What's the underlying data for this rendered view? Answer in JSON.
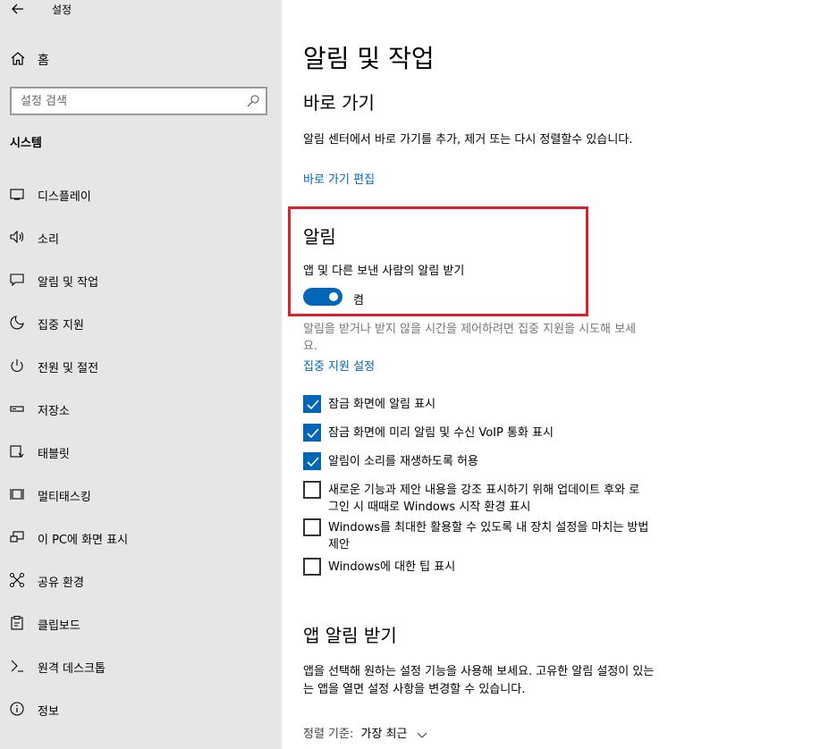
{
  "window": {
    "title": "설정",
    "back_icon": "back-arrow-icon"
  },
  "sidebar": {
    "home_label": "홈",
    "search_placeholder": "설정 검색",
    "section_title": "시스템",
    "items": [
      {
        "label": "디스플레이",
        "icon": "display-icon"
      },
      {
        "label": "소리",
        "icon": "sound-icon"
      },
      {
        "label": "알림 및 작업",
        "icon": "notification-icon"
      },
      {
        "label": "집중 지원",
        "icon": "focus-assist-icon"
      },
      {
        "label": "전원 및 절전",
        "icon": "power-icon"
      },
      {
        "label": "저장소",
        "icon": "storage-icon"
      },
      {
        "label": "태블릿",
        "icon": "tablet-icon"
      },
      {
        "label": "멀티태스킹",
        "icon": "multitasking-icon"
      },
      {
        "label": "이 PC에 화면 표시",
        "icon": "project-icon"
      },
      {
        "label": "공유 환경",
        "icon": "shared-experiences-icon"
      },
      {
        "label": "클립보드",
        "icon": "clipboard-icon"
      },
      {
        "label": "원격 데스크톱",
        "icon": "remote-desktop-icon"
      },
      {
        "label": "정보",
        "icon": "info-icon"
      }
    ]
  },
  "main": {
    "page_title": "알림 및 작업",
    "quick_actions": {
      "heading": "바로 가기",
      "description": "알림 센터에서 바로 가기를 추가, 제거 또는 다시 정렬할수 있습니다.",
      "edit_link": "바로 가기 편집"
    },
    "notifications": {
      "heading": "알림",
      "toggle_label": "앱 및 다른 보낸 사람의 알림 받기",
      "toggle_state": "켬",
      "toggle_on": true,
      "focus_note_line1": "알림을 받거나 받지 않을 시간을 제어하려면 집중 지원을 시도해 보세",
      "focus_note_line2": "요.",
      "focus_link": "집중 지원 설정",
      "checkboxes": [
        {
          "label": "잠금 화면에 알림 표시",
          "checked": true
        },
        {
          "label": "잠금 화면에 미리 알림 및 수신 VoIP 통화 표시",
          "checked": true
        },
        {
          "label": "알림이 소리를 재생하도록 허용",
          "checked": true
        },
        {
          "label_line1": "새로운 기능과 제안 내용을 강조 표시하기 위해 업데이트 후와 로",
          "label_line2": "그인 시 때때로 Windows 시작 환경 표시",
          "checked": false
        },
        {
          "label_line1": "Windows를 최대한 활용할 수 있도록 내 장치 설정을 마치는 방법",
          "label_line2": "제안",
          "checked": false
        },
        {
          "label": "Windows에 대한 팁 표시",
          "checked": false
        }
      ]
    },
    "app_notifications": {
      "heading": "앱 알림 받기",
      "description_line1": "앱을 선택해 원하는 설정 기능을 사용해 보세요. 고유한 알림 설정이 있는",
      "description_line2": "는 앱을 열면 설정 사항을 변경할 수 있습니다.",
      "sort_label": "정렬 기준:",
      "sort_value": "가장 최근"
    }
  },
  "colors": {
    "accent": "#0067b8",
    "sidebar_bg": "#e6e6e6",
    "highlight": "#d8232a"
  }
}
